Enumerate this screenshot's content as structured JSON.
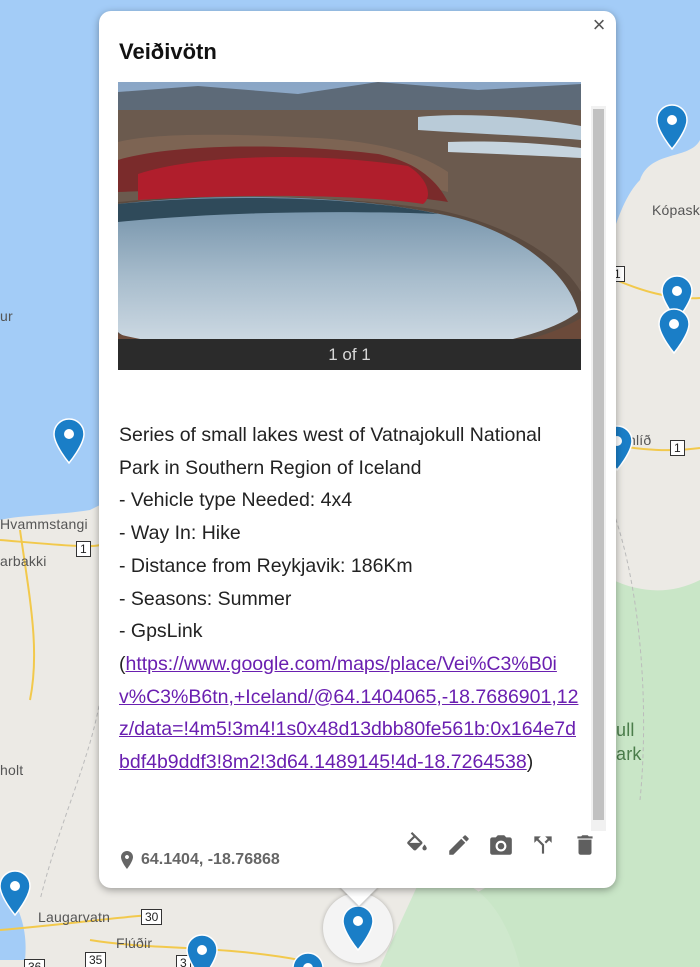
{
  "popup": {
    "title": "Veiðivötn",
    "close_label": "×",
    "photo_counter": "1 of 1",
    "description_lines": [
      "Series of small lakes west of Vatnajokull National",
      "Park in Southern Region of Iceland",
      "- Vehicle type Needed: 4x4",
      "- Way In: Hike",
      "- Distance from Reykjavik: 186Km",
      "- Seasons: Summer",
      "- GpsLink"
    ],
    "link_open": "(",
    "link_text": "https://www.google.com/maps/place/Vei%C3%B0iv%C3%B6tn,+Iceland/@64.1404065,-18.7686901,12z/data=!4m5!3m4!1s0x48d13dbb80fe561b:0x164e7dbdf4b9ddf3!8m2!3d64.1489145!4d-18.7264538",
    "link_close": ")",
    "coordinates": "64.1404, -18.76868",
    "actions": {
      "style": "paint-bucket-icon",
      "edit": "pencil-icon",
      "photo": "camera-icon",
      "directions": "directions-fork-icon",
      "delete": "trash-icon"
    }
  },
  "map": {
    "labels": {
      "kopask": "Kópask",
      "ur": "ur",
      "hlid": "hlíð",
      "hvammstangi": "Hvammstangi",
      "arbakki": "arbakki",
      "holt": "holt",
      "ull": "ull",
      "ark": "ark",
      "laugarvatn": "Laugarvatn",
      "fludir": "Flúðir"
    },
    "route_badges": {
      "r1_top": "1",
      "r1_right": "1",
      "r1_left": "1",
      "r30": "30",
      "r35": "35",
      "r36": "36",
      "r3": "3"
    },
    "colors": {
      "water": "#a3ccf7",
      "land": "#eceae5",
      "park": "#c9e6c7",
      "pin": "#1a7ec7",
      "link": "#6a1fb0"
    }
  }
}
